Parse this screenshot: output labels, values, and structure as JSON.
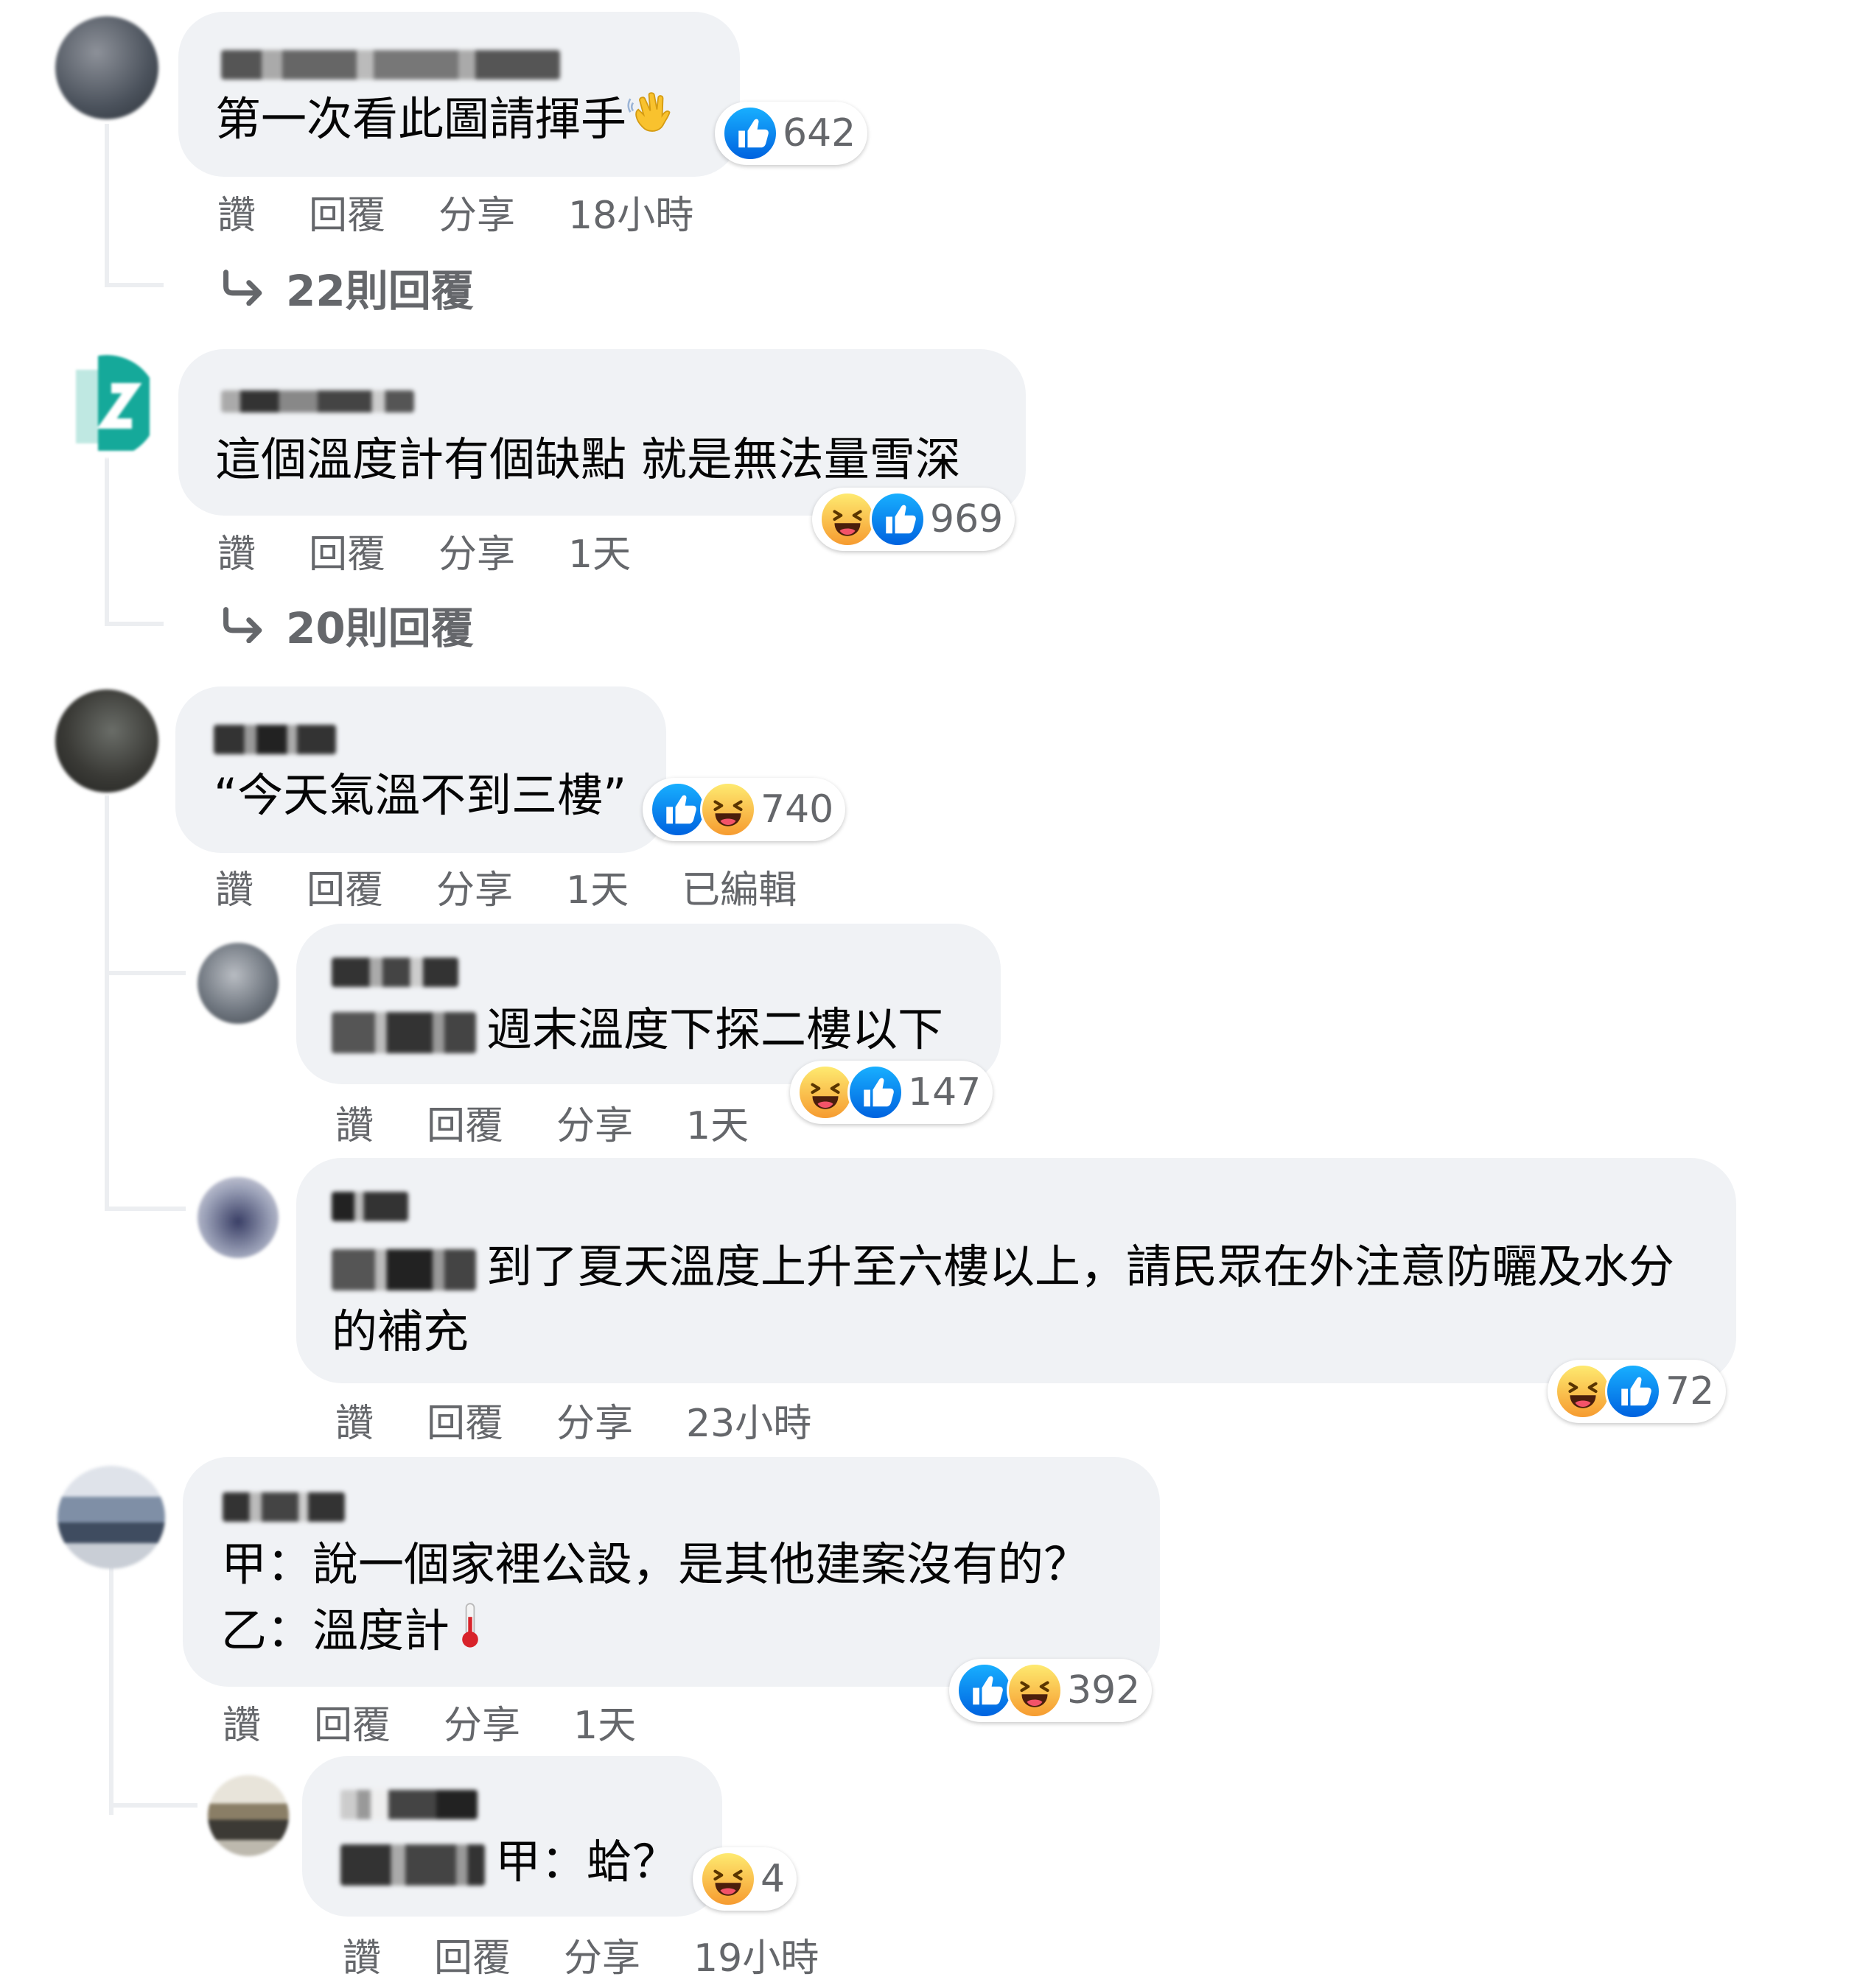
{
  "comments": [
    {
      "text": "第一次看此圖請揮手",
      "reaction_count": "642",
      "actions": {
        "like": "讚",
        "reply": "回覆",
        "share": "分享",
        "time": "18小時"
      },
      "view_replies": "22則回覆"
    },
    {
      "text": "這個溫度計有個缺點 就是無法量雪深",
      "reaction_count": "969",
      "actions": {
        "like": "讚",
        "reply": "回覆",
        "share": "分享",
        "time": "1天"
      },
      "view_replies": "20則回覆"
    },
    {
      "text": "“今天氣溫不到三樓”",
      "reaction_count": "740",
      "actions": {
        "like": "讚",
        "reply": "回覆",
        "share": "分享",
        "time": "1天",
        "edited": "已編輯"
      }
    },
    {
      "text": "週末溫度下探二樓以下",
      "reaction_count": "147",
      "actions": {
        "like": "讚",
        "reply": "回覆",
        "share": "分享",
        "time": "1天"
      }
    },
    {
      "text": "到了夏天溫度上升至六樓以上，請民眾在外注意防曬及水分的補充",
      "reaction_count": "72",
      "actions": {
        "like": "讚",
        "reply": "回覆",
        "share": "分享",
        "time": "23小時"
      }
    },
    {
      "text_line1": "甲：說一個家裡公設，是其他建案沒有的？",
      "text_line2": "乙：溫度計",
      "reaction_count": "392",
      "actions": {
        "like": "讚",
        "reply": "回覆",
        "share": "分享",
        "time": "1天"
      }
    },
    {
      "text": "甲：蛤？",
      "reaction_count": "4",
      "actions": {
        "like": "讚",
        "reply": "回覆",
        "share": "分享",
        "time": "19小時"
      }
    }
  ],
  "colors": {
    "bubble": "#f0f2f5",
    "secondary_text": "#65676b",
    "like_blue": "#0866ff",
    "haha_yellow": "#f7b125"
  },
  "icons": [
    "avatar",
    "waving-hand-emoji",
    "thermometer-emoji",
    "like-reaction-icon",
    "haha-reaction-icon",
    "reply-arrow-icon"
  ]
}
